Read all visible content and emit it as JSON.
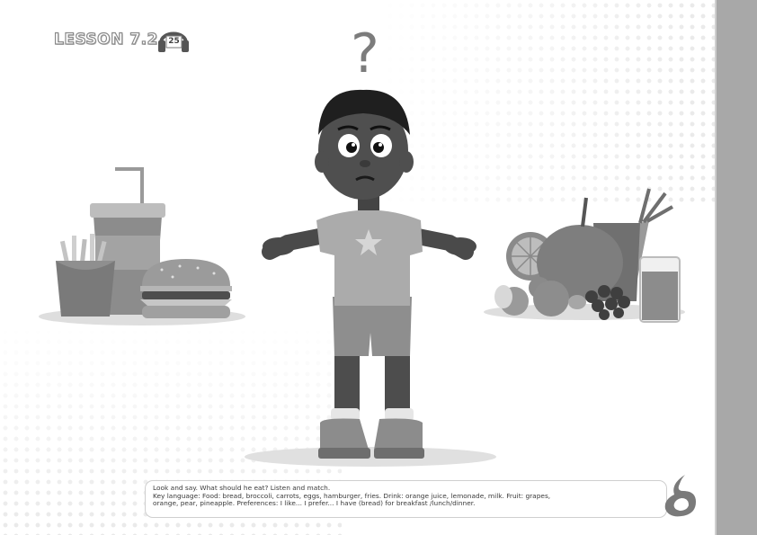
{
  "header": {
    "lesson_label": "LESSON 7.2",
    "audio_track": "25",
    "audio_icon": "headphones-icon"
  },
  "illustration": {
    "question_mark": "?"
  },
  "instructions": {
    "line1": "Look and say. What should he eat? Listen and match.",
    "line2": "Key language: Food: bread, broccoli, carrots, eggs, hamburger, fries. Drink: orange juice, lemonade, milk. Fruit: grapes,",
    "line3": "orange, pear, pineapple. Preferences: I like... I prefer... I have (bread) for breakfast /lunch/dinner."
  },
  "colors": {
    "side_bar": "#a8a8a8",
    "dots": "#e6e6e6"
  }
}
